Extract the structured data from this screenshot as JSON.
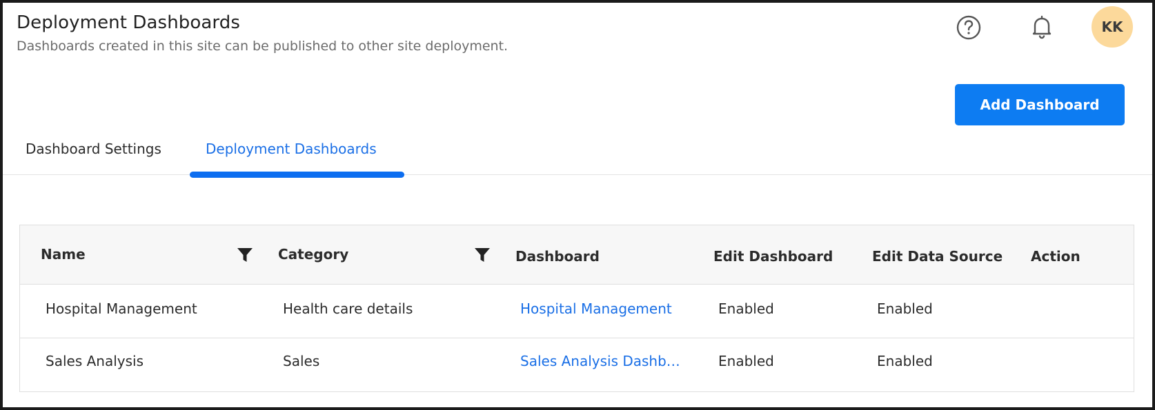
{
  "header": {
    "title": "Deployment Dashboards",
    "subtitle": "Dashboards created in this site can be published to other site deployment.",
    "help_icon": "help-circle-icon",
    "notification_icon": "bell-icon",
    "avatar_initials": "KK",
    "avatar_color": "#fcd99b"
  },
  "toolbar": {
    "add_dashboard_label": "Add Dashboard",
    "button_color": "#0d7cf2"
  },
  "tabs": [
    {
      "label": "Dashboard Settings",
      "active": false
    },
    {
      "label": "Deployment Dashboards",
      "active": true
    }
  ],
  "accent_color": "#1a6fe6",
  "table": {
    "columns": [
      "Name",
      "Category",
      "Dashboard",
      "Edit Dashboard",
      "Edit Data Source",
      "Action"
    ],
    "filter_icon": "filter-icon",
    "rows": [
      {
        "name": "Hospital Management",
        "category": "Health care details",
        "dashboard": "Hospital Management",
        "edit_dashboard": "Enabled",
        "edit_data_source": "Enabled",
        "action": ""
      },
      {
        "name": "Sales Analysis",
        "category": "Sales",
        "dashboard": "Sales Analysis Dashboard",
        "edit_dashboard": "Enabled",
        "edit_data_source": "Enabled",
        "action": ""
      }
    ]
  }
}
